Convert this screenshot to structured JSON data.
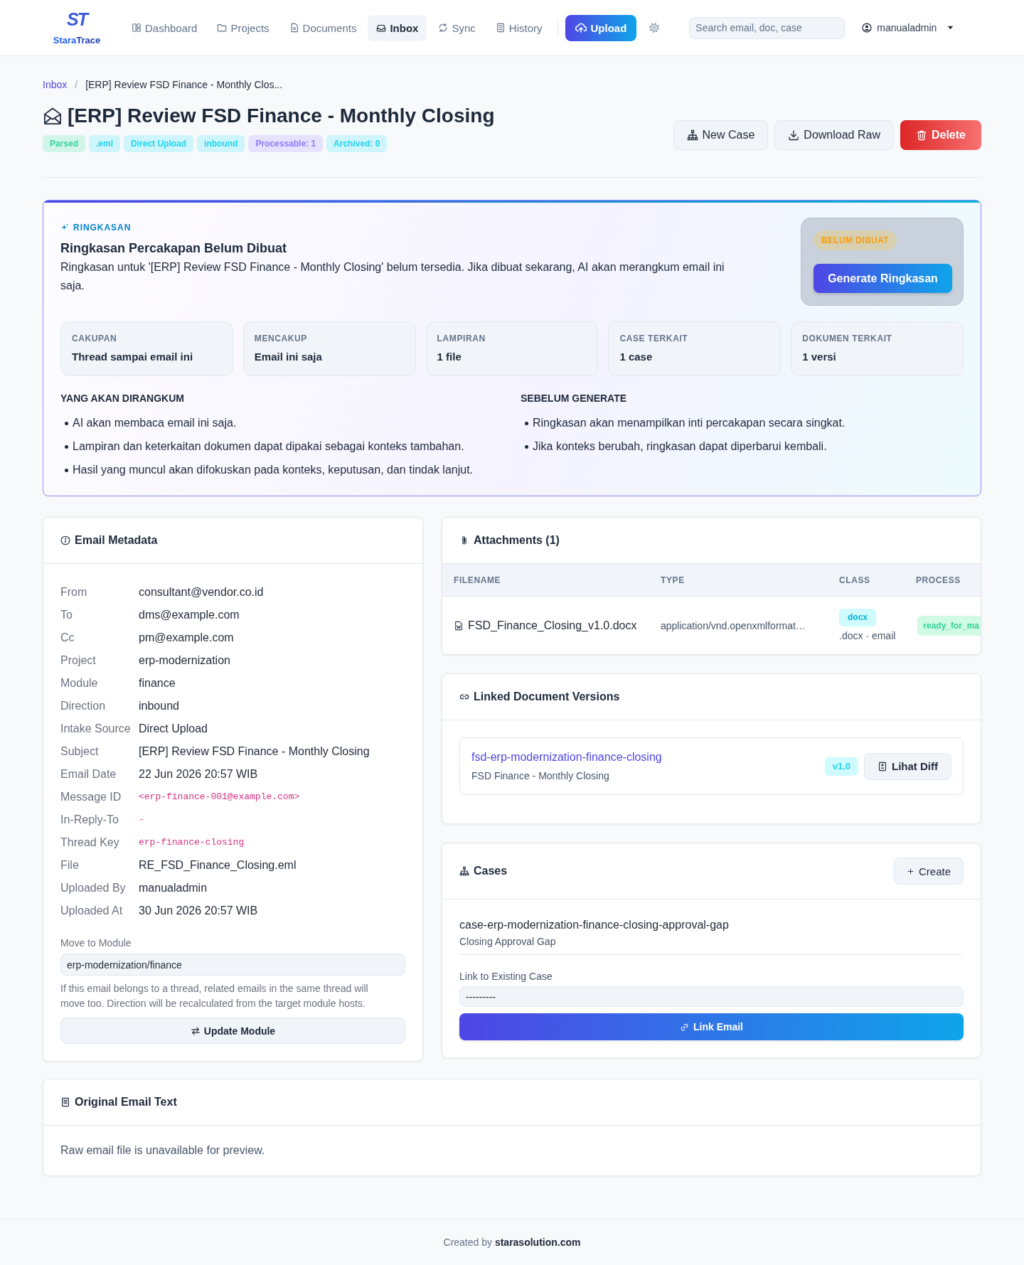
{
  "nav": {
    "logo_mark": "ST",
    "brand": {
      "first": "Stara",
      "second": "Trace"
    },
    "items": [
      {
        "label": "Dashboard",
        "kind": "dashboard",
        "selected": false
      },
      {
        "label": "Projects",
        "kind": "projects",
        "selected": false
      },
      {
        "label": "Documents",
        "kind": "documents",
        "selected": false
      },
      {
        "label": "Inbox",
        "kind": "inbox",
        "selected": true
      },
      {
        "label": "Sync",
        "kind": "sync",
        "selected": false
      },
      {
        "label": "History",
        "kind": "history",
        "selected": false
      }
    ],
    "upload": "Upload",
    "search": {
      "placeholder": "Search email, doc, case"
    },
    "user": "manualadmin"
  },
  "breadcrumb": {
    "parent": "Inbox",
    "separator": "/",
    "current": "[ERP] Review FSD Finance - Monthly Clos..."
  },
  "title": "[ERP] Review FSD Finance - Monthly Closing",
  "badges": [
    {
      "label": "Parsed",
      "color": "#34d399"
    },
    {
      "label": ".eml",
      "color": "#22d3ee"
    },
    {
      "label": "Direct Upload",
      "color": "#22d3ee"
    },
    {
      "label": "inbound",
      "color": "#22d3ee"
    },
    {
      "label": "Processable: 1",
      "color": "#8b7cf6"
    },
    {
      "label": "Archived: 0",
      "color": "#22d3ee"
    }
  ],
  "actions": [
    {
      "label": "New Case",
      "kind": "case"
    },
    {
      "label": "Download Raw",
      "kind": "download"
    },
    {
      "label": "Delete",
      "kind": "delete"
    }
  ],
  "summary": {
    "label": "RINGKASAN",
    "heading": "Ringkasan Percakapan Belum Dibuat",
    "text": "Ringkasan untuk '[ERP] Review FSD Finance - Monthly Closing' belum tersedia. Jika dibuat sekarang, AI akan merangkum email ini saja.",
    "status": "BELUM DIBUAT",
    "generate": "Generate Ringkasan",
    "stats": [
      {
        "label": "CAKUPAN",
        "value": "Thread sampai email ini"
      },
      {
        "label": "MENCAKUP",
        "value": "Email ini saja"
      },
      {
        "label": "LAMPIRAN",
        "value": "1 file"
      },
      {
        "label": "CASE TERKAIT",
        "value": "1 case"
      },
      {
        "label": "DOKUMEN TERKAIT",
        "value": "1 versi"
      }
    ],
    "lists": [
      {
        "heading": "YANG AKAN DIRANGKUM",
        "items": [
          "AI akan membaca email ini saja.",
          "Lampiran dan keterkaitan dokumen dapat dipakai sebagai konteks tambahan.",
          "Hasil yang muncul akan difokuskan pada konteks, keputusan, dan tindak lanjut."
        ]
      },
      {
        "heading": "SEBELUM GENERATE",
        "items": [
          "Ringkasan akan menampilkan inti percakapan secara singkat.",
          "Jika konteks berubah, ringkasan dapat diperbarui kembali."
        ]
      }
    ]
  },
  "metadata": {
    "title": "Email Metadata",
    "rows": [
      {
        "label": "From",
        "value": "consultant@vendor.co.id",
        "kind": "text"
      },
      {
        "label": "To",
        "value": "dms@example.com",
        "kind": "text"
      },
      {
        "label": "Cc",
        "value": "pm@example.com",
        "kind": "text"
      },
      {
        "label": "Project",
        "value": "erp-modernization",
        "kind": "text"
      },
      {
        "label": "Module",
        "value": "finance",
        "kind": "text"
      },
      {
        "label": "Direction",
        "value": "inbound",
        "kind": "text"
      },
      {
        "label": "Intake Source",
        "value": "Direct Upload",
        "kind": "text"
      },
      {
        "label": "Subject",
        "value": "[ERP] Review FSD Finance - Monthly Closing",
        "kind": "text"
      },
      {
        "label": "Email Date",
        "value": "22 Jun 2026 20:57 WIB",
        "kind": "text"
      },
      {
        "label": "Message ID",
        "value": "<erp-finance-001@example.com>",
        "kind": "code"
      },
      {
        "label": "In-Reply-To",
        "value": "-",
        "kind": "code"
      },
      {
        "label": "Thread Key",
        "value": "erp-finance-closing",
        "kind": "code"
      },
      {
        "label": "File",
        "value": "RE_FSD_Finance_Closing.eml",
        "kind": "text"
      },
      {
        "label": "Uploaded By",
        "value": "manualadmin",
        "kind": "text"
      },
      {
        "label": "Uploaded At",
        "value": "30 Jun 2026 20:57 WIB",
        "kind": "text"
      }
    ],
    "move": {
      "label": "Move to Module",
      "value": "erp-modernization/finance",
      "help": "If this email belongs to a thread, related emails in the same thread will move too. Direction will be recalculated from the target module hosts.",
      "button": "Update Module"
    }
  },
  "attachments": {
    "title": "Attachments (1)",
    "columns": [
      "FILENAME",
      "TYPE",
      "CLASS",
      "PROCESS"
    ],
    "rows": [
      {
        "filename": "FSD_Finance_Closing_v1.0.docx",
        "type": "application/vnd.openxmlformat…",
        "class_badge": "docx",
        "class_detail": ".docx · email",
        "process": "ready_for_ma"
      }
    ]
  },
  "linked_versions": {
    "title": "Linked Document Versions",
    "items": [
      {
        "name": "fsd-erp-modernization-finance-closing",
        "subtitle": "FSD Finance - Monthly Closing",
        "version": "v1.0",
        "button": "Lihat Diff"
      }
    ]
  },
  "cases": {
    "title": "Cases",
    "create": "Create",
    "items": [
      {
        "name": "case-erp-modernization-finance-closing-approval-gap",
        "subtitle": "Closing Approval Gap"
      }
    ],
    "link_label": "Link to Existing Case",
    "select_value": "---------",
    "link_button": "Link Email"
  },
  "original": {
    "title": "Original Email Text",
    "text": "Raw email file is unavailable for preview."
  },
  "footer": "Created by **starasolution.com**"
}
